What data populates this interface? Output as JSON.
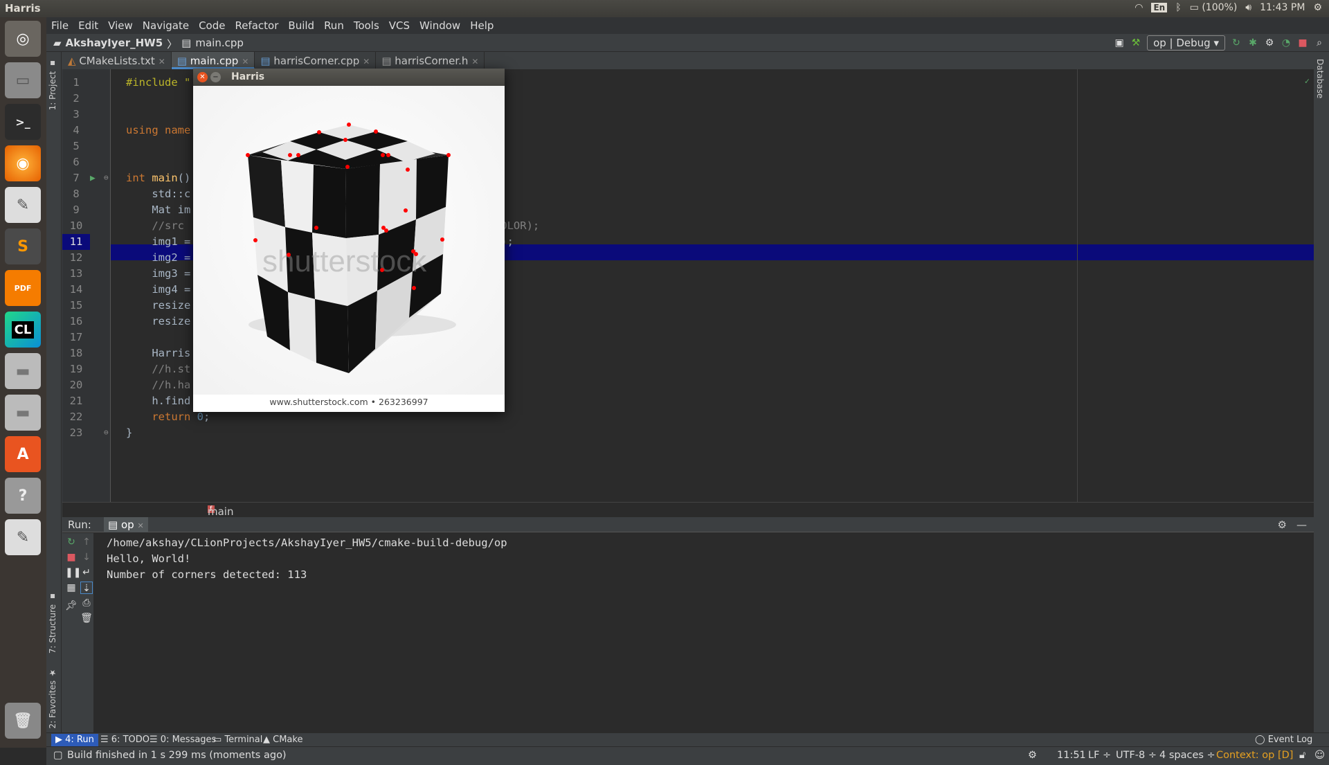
{
  "os": {
    "window_title": "Harris",
    "tray": {
      "lang": "En",
      "battery": "(100%)",
      "time": "11:43 PM"
    },
    "launcher": [
      "Ubuntu Dash",
      "Files",
      "Terminal",
      "Firefox",
      "Text Editor",
      "Sublime Text",
      "PDF",
      "CLion",
      "Disk",
      "Disk",
      "Software Center",
      "Help",
      "Text Editor",
      "Trash"
    ]
  },
  "menubar": [
    "File",
    "Edit",
    "View",
    "Navigate",
    "Code",
    "Refactor",
    "Build",
    "Run",
    "Tools",
    "VCS",
    "Window",
    "Help"
  ],
  "navbar": {
    "project": "AkshayIyer_HW5",
    "file": "main.cpp",
    "config": "op | Debug"
  },
  "side_tabs": {
    "project": "1: Project",
    "structure": "7: Structure",
    "favorites": "2: Favorites",
    "database": "Database"
  },
  "tabs": [
    {
      "label": "CMakeLists.txt"
    },
    {
      "label": "main.cpp"
    },
    {
      "label": "harrisCorner.cpp"
    },
    {
      "label": "harrisCorner.h"
    }
  ],
  "editor": {
    "line_numbers": [
      "1",
      "2",
      "3",
      "4",
      "5",
      "6",
      "7",
      "8",
      "9",
      "10",
      "11",
      "12",
      "13",
      "14",
      "15",
      "16",
      "17",
      "18",
      "19",
      "20",
      "21",
      "22",
      "23"
    ],
    "current_line": "11",
    "breadcrumb": "main"
  },
  "harris_window": {
    "title": "Harris",
    "footer": "www.shutterstock.com • 263236997",
    "watermark": "shutterstock"
  },
  "run": {
    "label": "Run:",
    "config": "op",
    "output": [
      "/home/akshay/CLionProjects/AkshayIyer_HW5/cmake-build-debug/op",
      "Hello, World!",
      "Number of corners detected: 113"
    ]
  },
  "bottom_tabs": [
    "4: Run",
    "6: TODO",
    "0: Messages",
    "Terminal",
    "CMake"
  ],
  "event_log": "Event Log",
  "status": {
    "message": "Build finished in 1 s 299 ms (moments ago)",
    "position": "11:51",
    "line_sep": "LF",
    "encoding": "UTF-8",
    "indent": "4 spaces",
    "context": "Context: op [D]"
  }
}
